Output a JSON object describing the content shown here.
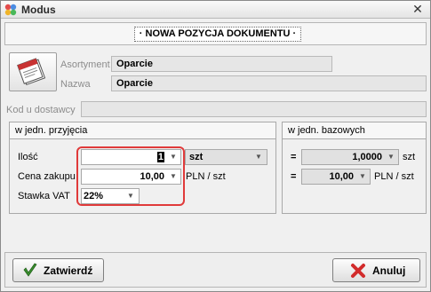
{
  "window": {
    "title": "Modus"
  },
  "header": {
    "label": "· NOWA POZYCJA DOKUMENTU ·"
  },
  "product": {
    "asortyment_label": "Asortyment",
    "asortyment_value": "Oparcie",
    "nazwa_label": "Nazwa",
    "nazwa_value": "Oparcie",
    "kod_label": "Kod u dostawcy",
    "kod_value": ""
  },
  "receipt_units": {
    "title": "w jedn. przyjęcia",
    "ilosc_label": "Ilość",
    "ilosc_value": "1",
    "ilosc_unit": "szt",
    "cena_label": "Cena zakupu",
    "cena_value": "10,00",
    "cena_unit": "PLN / szt",
    "vat_label": "Stawka VAT",
    "vat_value": "22%"
  },
  "base_units": {
    "title": "w jedn. bazowych",
    "eq1": "=",
    "qty_value": "1,0000",
    "qty_unit": "szt",
    "eq2": "=",
    "price_value": "10,00",
    "price_unit": "PLN / szt"
  },
  "buttons": {
    "confirm": "Zatwierdź",
    "cancel": "Anuluj"
  },
  "colors": {
    "highlight": "#e03a3a",
    "confirm_icon": "#3a8f2e",
    "cancel_icon": "#d22b2b"
  }
}
